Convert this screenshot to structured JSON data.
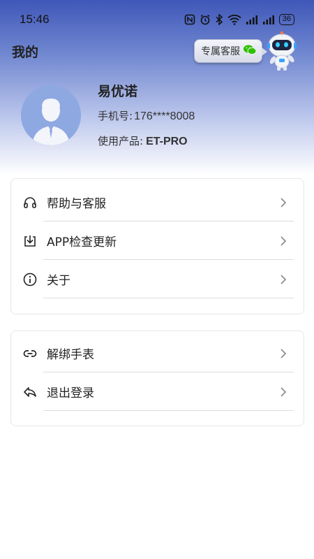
{
  "status_bar": {
    "time": "15:46",
    "battery": "36",
    "icons": [
      "nfc-icon",
      "alarm-icon",
      "bluetooth-icon",
      "wifi-icon",
      "signal-icon",
      "signal-icon",
      "battery-icon"
    ]
  },
  "header": {
    "title": "我的",
    "customer_service_label": "专属客服",
    "gradient_top_color": "#3f57b8"
  },
  "profile": {
    "name": "易优诺",
    "phone_label": "手机号:",
    "phone_value": "176****8008",
    "product_label": "使用产品:",
    "product_value": "ET-PRO"
  },
  "menu_group_1": [
    {
      "label": "帮助与客服",
      "icon": "headset-icon"
    },
    {
      "label": "APP检查更新",
      "icon": "download-icon"
    },
    {
      "label": "关于",
      "icon": "info-icon"
    }
  ],
  "menu_group_2": [
    {
      "label": "解绑手表",
      "icon": "link-icon"
    },
    {
      "label": "退出登录",
      "icon": "reply-icon"
    }
  ],
  "colors": {
    "wechat_green": "#2dc100",
    "avatar_bg": "#8aa6e0"
  }
}
